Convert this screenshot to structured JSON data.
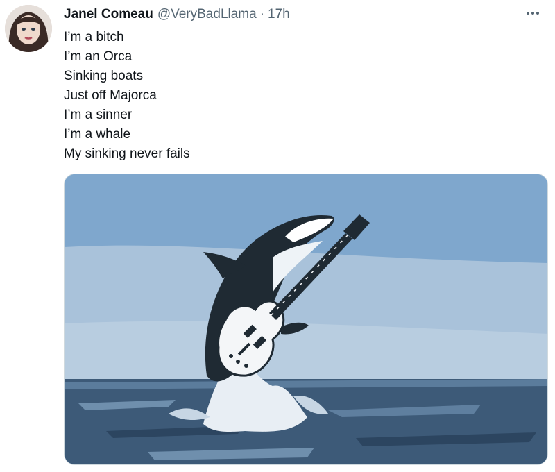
{
  "tweet": {
    "author_name": "Janel Comeau",
    "author_handle": "@VeryBadLlama",
    "separator": "·",
    "timestamp": "17h",
    "lines": [
      "I’m a bitch",
      "I’m an Orca",
      "Sinking boats",
      "Just off Majorca",
      "I’m a sinner",
      "I’m a whale",
      "My sinking never fails"
    ]
  },
  "icons": {
    "more": "more-horizontal-icon"
  },
  "colors": {
    "text_primary": "#0f1419",
    "text_secondary": "#536471",
    "sky": "#7fa7cd",
    "sea": "#3d5a78"
  }
}
